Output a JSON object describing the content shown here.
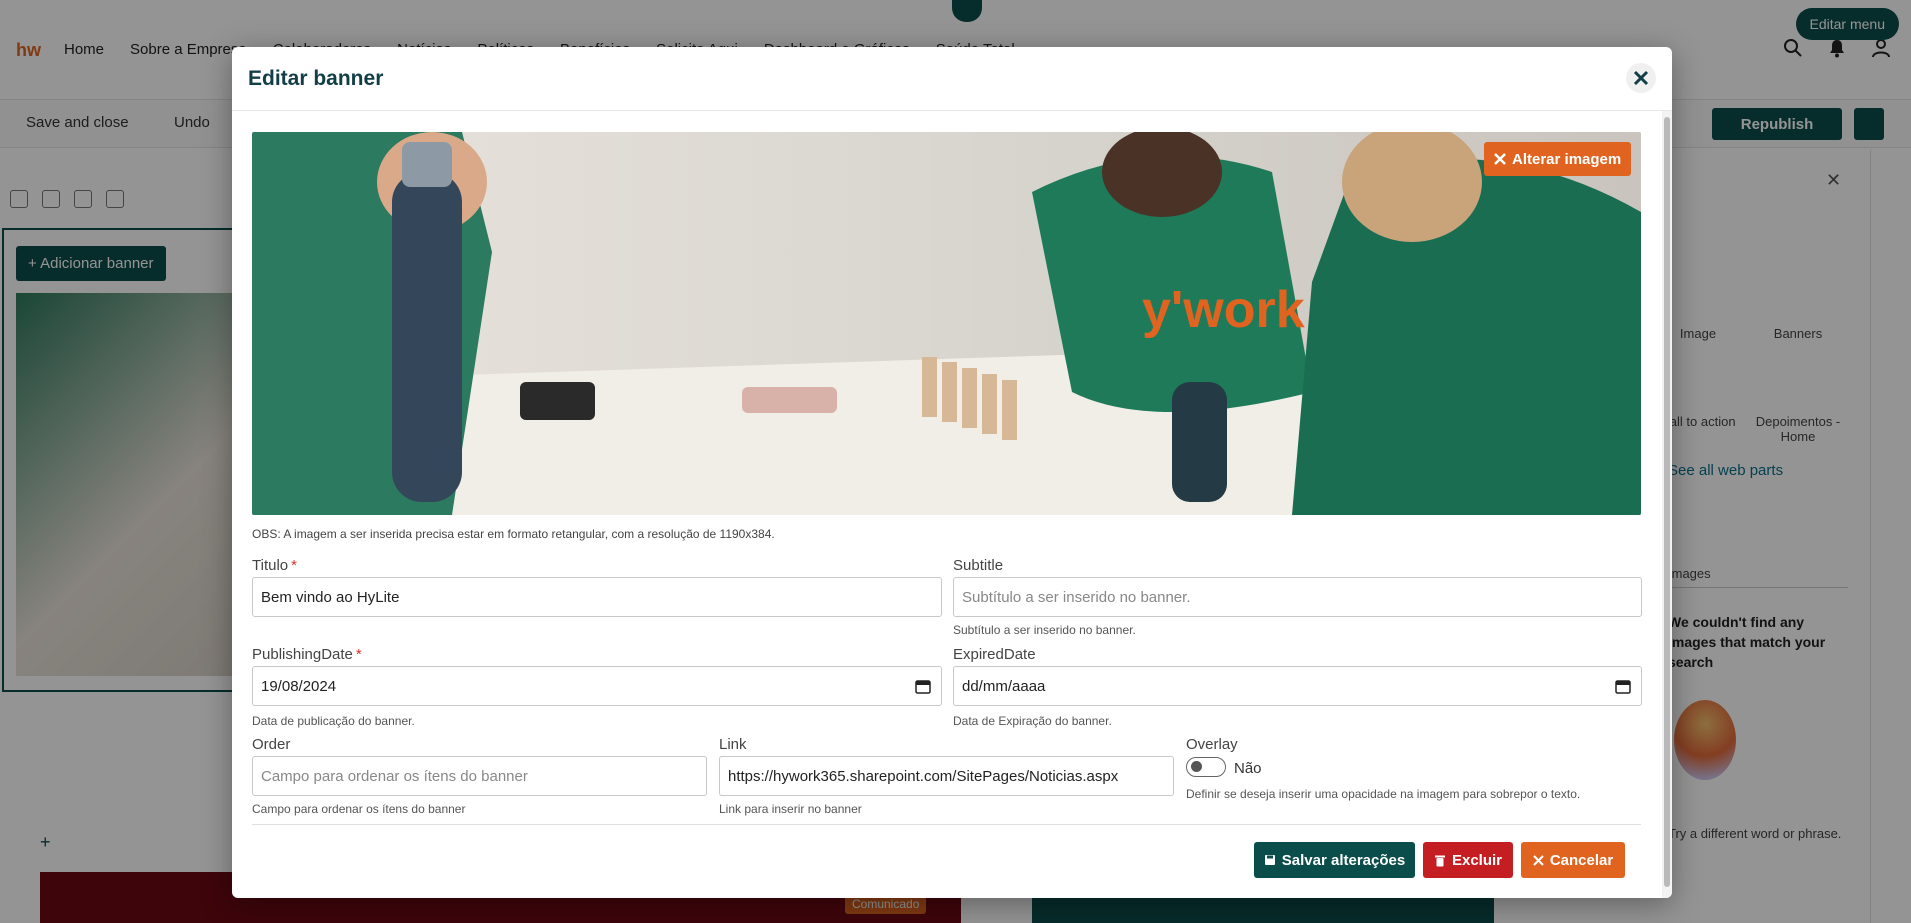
{
  "site": {
    "brand": "hw",
    "nav": [
      "Home",
      "Sobre a Empresa",
      "Colaboradores",
      "Notícias",
      "Políticas",
      "Benefícios",
      "Solicite Aqui",
      "Dashboard e Gráficos",
      "Saúde Total"
    ],
    "edit_menu_label": "Editar menu"
  },
  "command_bar": {
    "save_close": "Save and close",
    "undo": "Undo",
    "republish": "Republish"
  },
  "canvas": {
    "add_banner": "+ Adicionar banner",
    "badge": "Comunicado"
  },
  "toolbox": {
    "tiles": [
      "Image",
      "Banners",
      "Call to action",
      "Depoimentos - Home"
    ],
    "see_all": "See all web parts",
    "images_heading": "Images",
    "no_results": "We couldn't find any images that match your search",
    "try_hint": "Try a different word or phrase."
  },
  "modal": {
    "title": "Editar banner",
    "change_image": "Alterar imagem",
    "note": "OBS: A imagem a ser inserida precisa estar em formato retangular, com a resolução de 1190x384.",
    "fields": {
      "titulo": {
        "label": "Titulo",
        "value": "Bem vindo ao HyLite"
      },
      "subtitle": {
        "label": "Subtitle",
        "placeholder": "Subtítulo a ser inserido no banner.",
        "help": "Subtítulo a ser inserido no banner."
      },
      "publishing_date": {
        "label": "PublishingDate",
        "value": "19/08/2024",
        "help": "Data de publicação do banner."
      },
      "expired_date": {
        "label": "ExpiredDate",
        "value": "dd/mm/aaaa",
        "help": "Data de Expiração do banner."
      },
      "order": {
        "label": "Order",
        "placeholder": "Campo para ordenar os ítens do banner",
        "help": "Campo para ordenar os ítens do banner"
      },
      "link": {
        "label": "Link",
        "value": "https://hywork365.sharepoint.com/SitePages/Noticias.aspx",
        "help": "Link para inserir no banner"
      },
      "overlay": {
        "label": "Overlay",
        "value": "Não",
        "help": "Definir se deseja inserir uma opacidade na imagem para sobrepor o texto."
      }
    },
    "buttons": {
      "save": "Salvar alterações",
      "delete": "Excluir",
      "cancel": "Cancelar"
    }
  },
  "colors": {
    "primary": "#0b4d4a",
    "accent": "#e0641f",
    "danger": "#c41e23"
  },
  "icons": [
    "chevron-down-icon",
    "search-icon",
    "notification-icon",
    "user-icon",
    "save-icon",
    "undo-icon",
    "close-icon",
    "trash-icon",
    "calendar-icon",
    "floppy-icon"
  ]
}
